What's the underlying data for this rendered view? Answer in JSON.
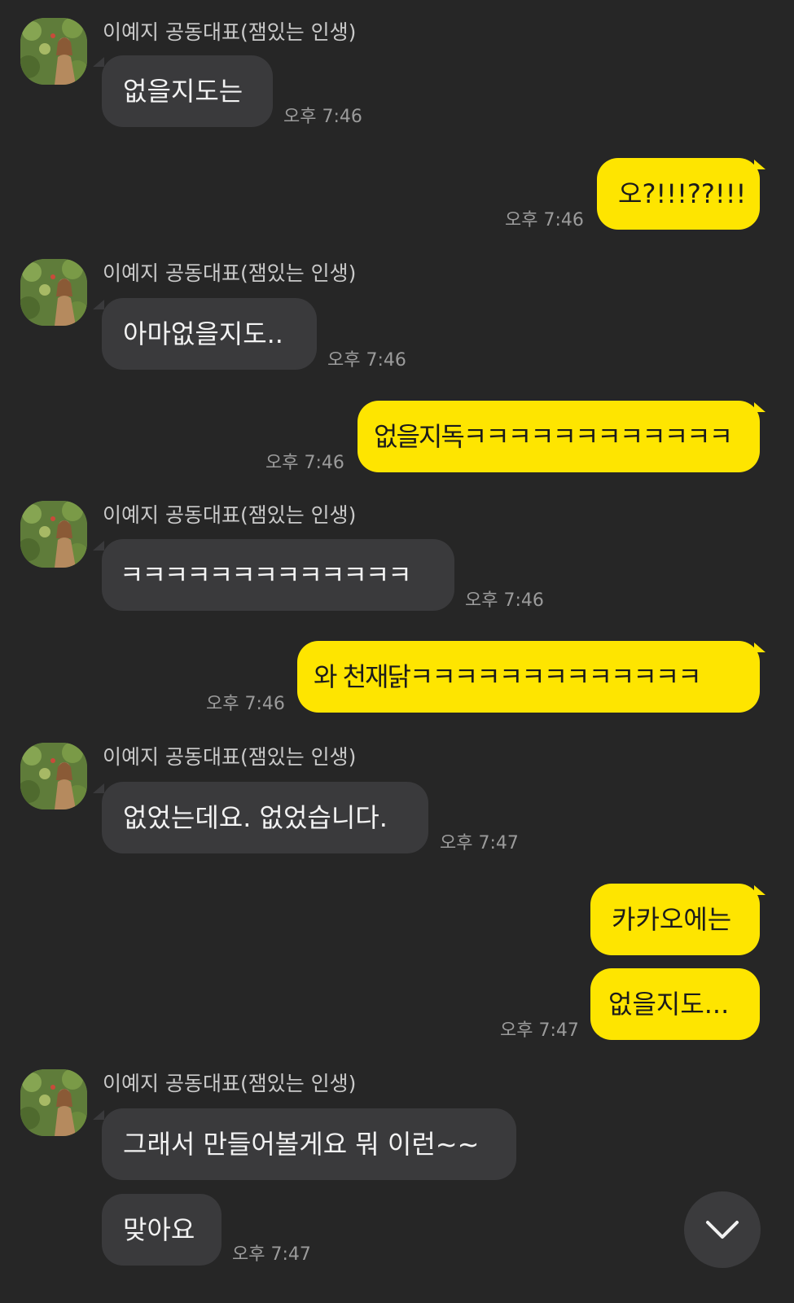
{
  "sender_name": "이예지 공동대표(잼있는 인생)",
  "messages": [
    {
      "text": "없을지도는",
      "time": "오후 7:46"
    },
    {
      "text": "오?!!!??!!!",
      "time": "오후 7:46"
    },
    {
      "text": "아마없을지도..",
      "time": "오후 7:46"
    },
    {
      "text": "없을지독ㅋㅋㅋㅋㅋㅋㅋㅋㅋㅋㅋㅋ",
      "time": "오후 7:46"
    },
    {
      "text": "ㅋㅋㅋㅋㅋㅋㅋㅋㅋㅋㅋㅋㅋ",
      "time": "오후 7:46"
    },
    {
      "text": "와 천재닭ㅋㅋㅋㅋㅋㅋㅋㅋㅋㅋㅋㅋㅋ",
      "time": "오후 7:46"
    },
    {
      "text": "없었는데요. 없었습니다.",
      "time": "오후 7:47"
    },
    {
      "text": "카카오에는"
    },
    {
      "text": "없을지도...",
      "time": "오후 7:47"
    },
    {
      "text": "그래서 만들어볼게요 뭐 이런~~"
    },
    {
      "text": "맞아요",
      "time": "오후 7:47"
    }
  ],
  "scroll_button_icon": "chevron-down-icon",
  "colors": {
    "background": "#262626",
    "incoming_bubble": "#3a3a3c",
    "outgoing_bubble": "#fee500",
    "sender_text": "#c9c9c9",
    "time_text": "#9b9b9b"
  }
}
